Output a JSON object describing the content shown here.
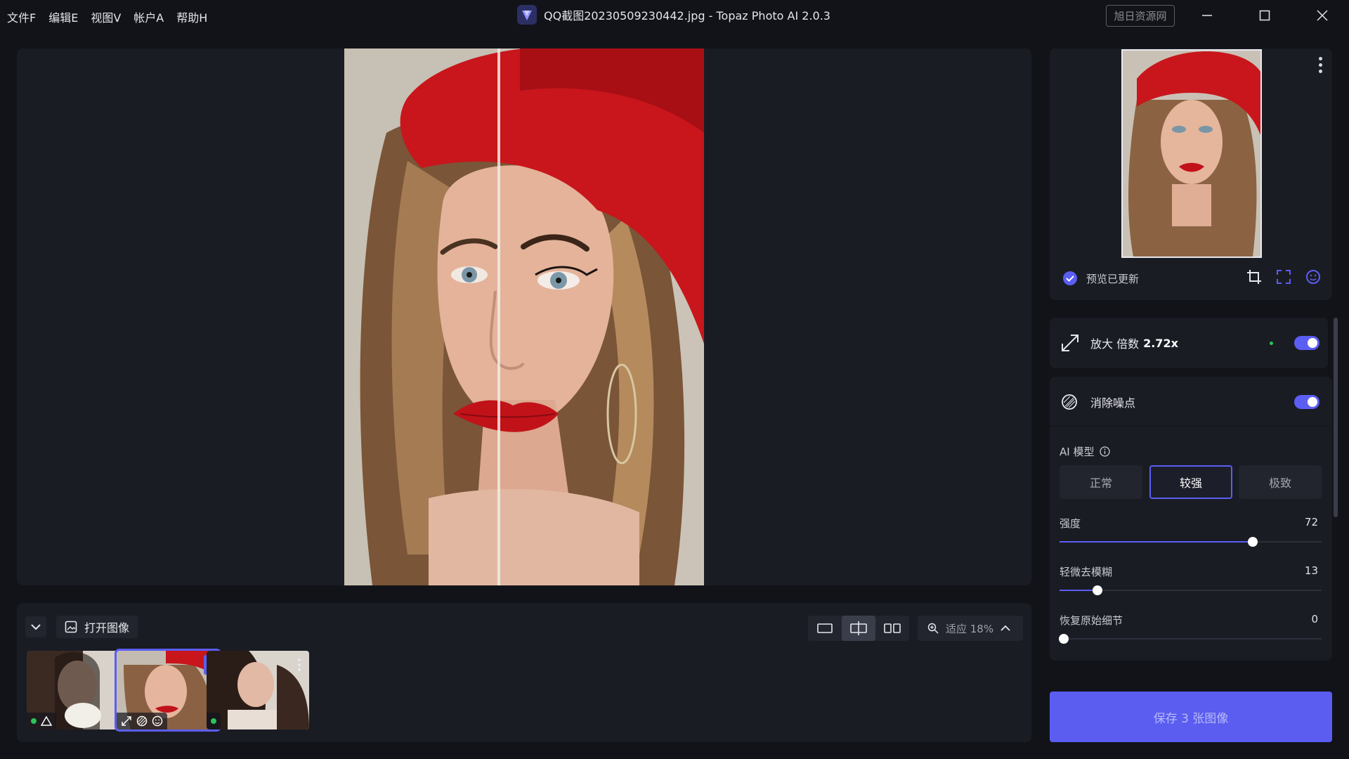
{
  "menu": [
    "文件F",
    "编辑E",
    "视图V",
    "帐户A",
    "帮助H"
  ],
  "window": {
    "title": "QQ截图20230509230442.jpg - Topaz Photo AI 2.0.3",
    "watermark": "旭日资源网"
  },
  "bottombar": {
    "open_label": "打开图像",
    "zoom_label": "适应 18%"
  },
  "preview": {
    "status": "预览已更新"
  },
  "upscale": {
    "label": "放大 倍数",
    "value": "2.72x",
    "enabled": true
  },
  "denoise": {
    "label": "消除噪点",
    "enabled": true,
    "model_label": "AI 模型",
    "models": [
      "正常",
      "较强",
      "极致"
    ],
    "selected_model": "较强",
    "sliders": [
      {
        "label": "强度",
        "value": "72",
        "level": 0.72
      },
      {
        "label": "轻微去模糊",
        "value": "13",
        "level": 0.13
      },
      {
        "label": "恢复原始细节",
        "value": "0",
        "level": 0.0
      }
    ]
  },
  "save": {
    "label": "保存 3 张图像"
  },
  "colors": {
    "accent": "#5b5ef3",
    "green": "#2bc35b",
    "panel": "#1a1c24",
    "bg": "#121319"
  },
  "icons": [
    "topaz-logo-icon",
    "minimize-icon",
    "maximize-icon",
    "close-icon",
    "chevron-down-icon",
    "image-icon",
    "single-view-icon",
    "split-view-icon",
    "side-by-side-icon",
    "zoom-icon",
    "chevron-up-icon",
    "more-icon",
    "check-circle-icon",
    "crop-icon",
    "fullscreen-icon",
    "face-icon",
    "upscale-icon",
    "denoise-icon",
    "info-icon"
  ]
}
